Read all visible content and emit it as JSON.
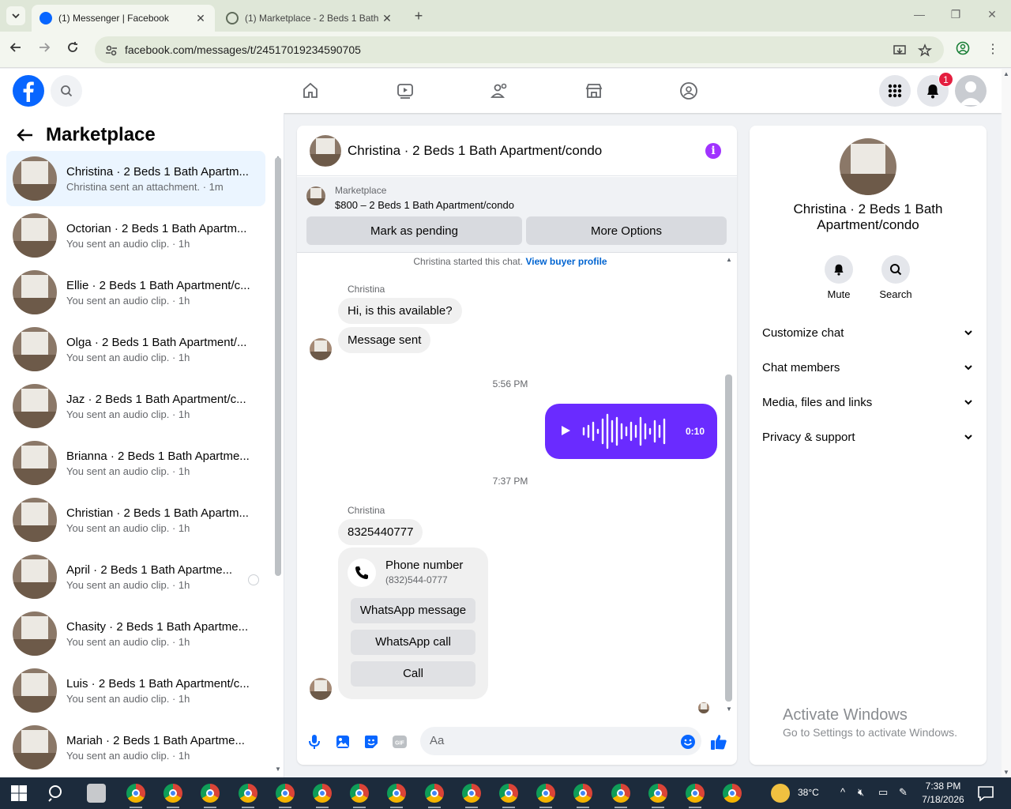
{
  "browser": {
    "tabs": [
      {
        "title": "(1) Messenger | Facebook",
        "active": true
      },
      {
        "title": "(1) Marketplace - 2 Beds 1 Bath",
        "active": false
      }
    ],
    "url": "facebook.com/messages/t/24517019234590705"
  },
  "header": {
    "notification_count": "1",
    "brand_color": "#0866ff"
  },
  "left_panel": {
    "title": "Marketplace",
    "conversations": [
      {
        "name": "Christina · 2 Beds 1 Bath Apartm...",
        "sub": "Christina sent an attachment. · 1m",
        "active": true
      },
      {
        "name": "Octorian · 2 Beds 1 Bath Apartm...",
        "sub": "You sent an audio clip. · 1h"
      },
      {
        "name": "Ellie · 2 Beds 1 Bath Apartment/c...",
        "sub": "You sent an audio clip. · 1h"
      },
      {
        "name": "Olga · 2 Beds 1 Bath Apartment/...",
        "sub": "You sent an audio clip. · 1h"
      },
      {
        "name": "Jaz · 2 Beds 1 Bath Apartment/c...",
        "sub": "You sent an audio clip. · 1h"
      },
      {
        "name": "Brianna · 2 Beds 1 Bath Apartme...",
        "sub": "You sent an audio clip. · 1h"
      },
      {
        "name": "Christian · 2 Beds 1 Bath Apartm...",
        "sub": "You sent an audio clip. · 1h"
      },
      {
        "name": "April · 2 Beds 1 Bath Apartme...",
        "sub": "You sent an audio clip. · 1h"
      },
      {
        "name": "Chasity · 2 Beds 1 Bath Apartme...",
        "sub": "You sent an audio clip. · 1h"
      },
      {
        "name": "Luis · 2 Beds 1 Bath Apartment/c...",
        "sub": "You sent an audio clip. · 1h"
      },
      {
        "name": "Mariah · 2 Beds 1 Bath Apartme...",
        "sub": "You sent an audio clip. · 1h"
      }
    ]
  },
  "chat": {
    "title": "Christina · 2 Beds 1 Bath Apartment/condo",
    "marketplace_label": "Marketplace",
    "listing": "$800 – 2 Beds 1 Bath Apartment/condo",
    "mark_pending": "Mark as pending",
    "more_options": "More Options",
    "started_text": "Christina started this chat.",
    "buyer_profile_link": "View buyer profile",
    "sender_name": "Christina",
    "msg1": "Hi, is this available?",
    "msg2": "Message sent",
    "time1": "5:56 PM",
    "audio_duration": "0:10",
    "time2": "7:37 PM",
    "msg3": "8325440777",
    "phone_card": {
      "title": "Phone number",
      "number": "(832)544-0777",
      "whatsapp_message": "WhatsApp message",
      "whatsapp_call": "WhatsApp call",
      "call": "Call"
    },
    "composer_placeholder": "Aa",
    "accent_color": "#6a2bff"
  },
  "right_panel": {
    "name_line1": "Christina · 2 Beds 1 Bath",
    "name_line2": "Apartment/condo",
    "mute": "Mute",
    "search": "Search",
    "sections": [
      "Customize chat",
      "Chat members",
      "Media, files and links",
      "Privacy & support"
    ]
  },
  "watermark": {
    "line1": "Activate Windows",
    "line2": "Go to Settings to activate Windows."
  },
  "taskbar": {
    "temperature": "38°C",
    "time": "7:38 PM",
    "date": "7/18/2026"
  }
}
